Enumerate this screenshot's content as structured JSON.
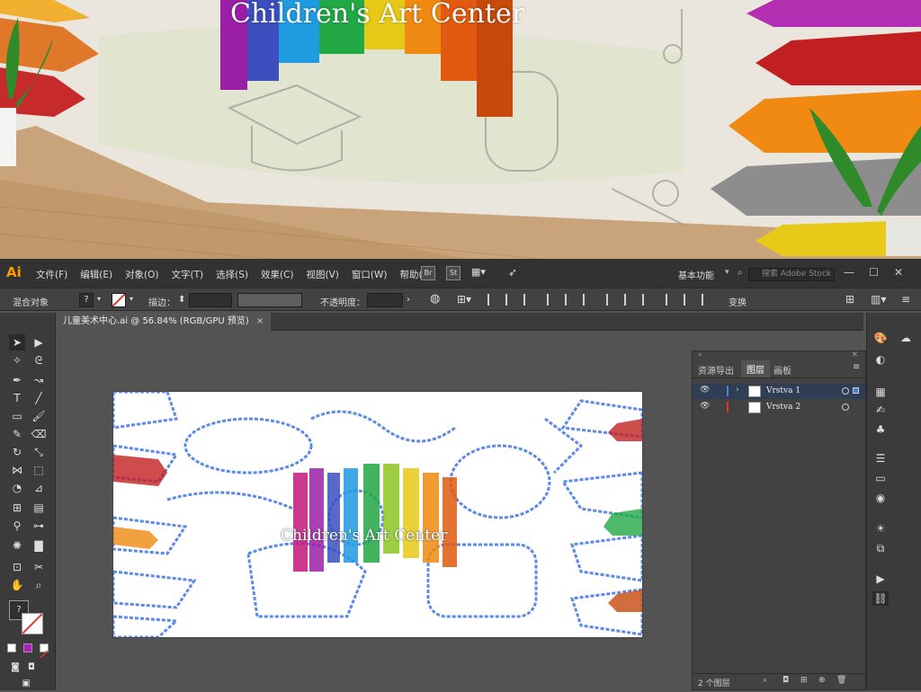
{
  "banner": {
    "title": "Children's Art Center"
  },
  "app": {
    "logo": "Ai"
  },
  "menu": [
    "文件(F)",
    "编辑(E)",
    "对象(O)",
    "文字(T)",
    "选择(S)",
    "效果(C)",
    "视图(V)",
    "窗口(W)",
    "帮助(H)"
  ],
  "bridge_btn": "Br",
  "stock_btn": "St",
  "workspace": "基本功能",
  "search": {
    "placeholder": "搜索 Adobe Stock"
  },
  "control": {
    "selection": "混合对象",
    "stroke_label": "描边：",
    "opacity_label": "不透明度：",
    "transform_label": "变换",
    "fill_placeholder": "?"
  },
  "document": {
    "tab_label": "儿童美术中心.ai @ 56.84% (RGB/GPU 预览)",
    "close": "×"
  },
  "artboard": {
    "title": "Children's Art Center"
  },
  "layers_panel": {
    "tabs": [
      "资源导出",
      "图层",
      "画板"
    ],
    "active_tab": "图层",
    "layers": [
      {
        "name": "Vrstva 1",
        "color": "#4f7fd7",
        "selected": true
      },
      {
        "name": "Vrstva 2",
        "color": "#e0392b",
        "selected": false
      }
    ],
    "count": "2 个图层"
  },
  "toolbar": {
    "unknown_swatch": "?"
  },
  "colors": {
    "accent_blue": "#4f7fd7",
    "ai_orange": "#ff9a00"
  }
}
